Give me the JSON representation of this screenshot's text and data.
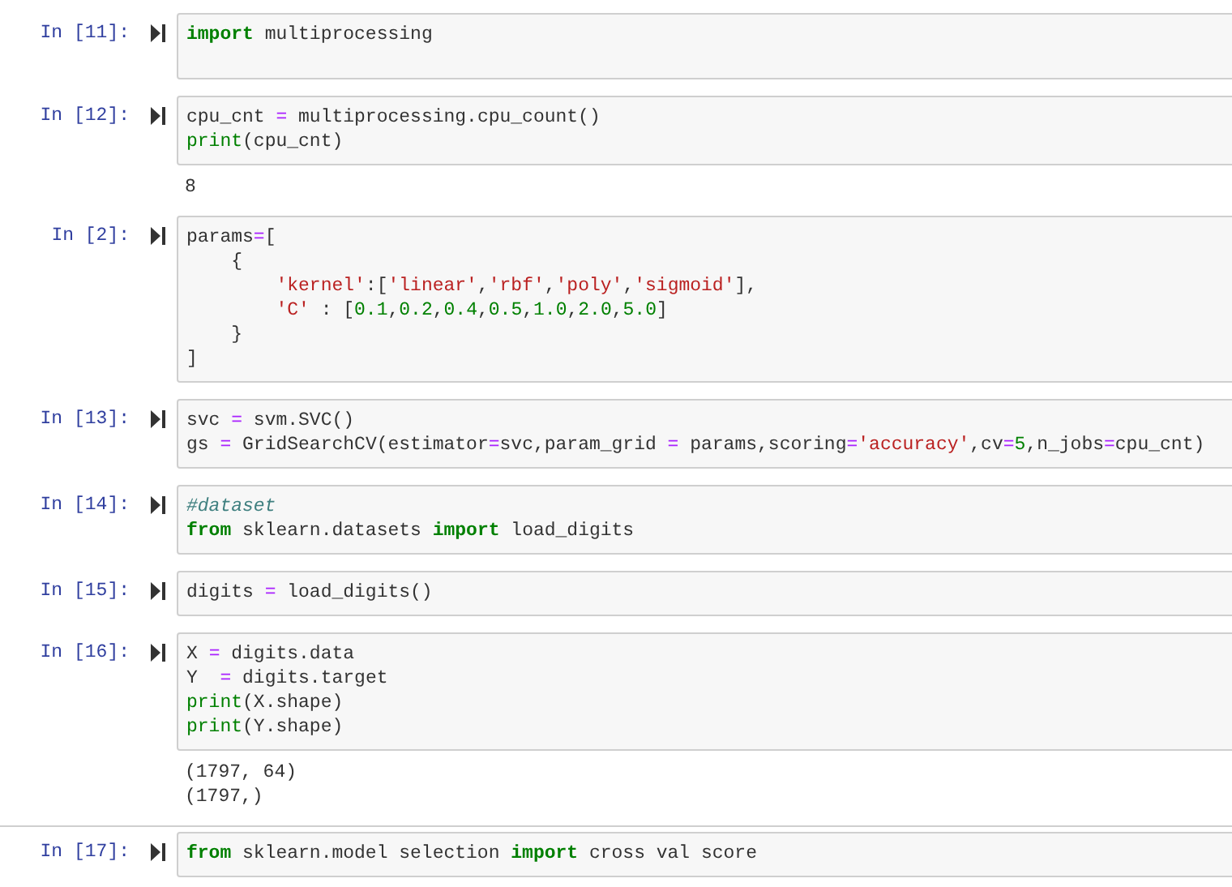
{
  "cells": [
    {
      "prompt": "In [11]:",
      "lines": [
        [
          {
            "kind": "kw",
            "text": "import"
          },
          {
            "kind": "p",
            "text": " multiprocessing"
          }
        ]
      ]
    },
    {
      "prompt": "In [12]:",
      "lines": [
        [
          {
            "kind": "p",
            "text": "cpu_cnt "
          },
          {
            "kind": "op",
            "text": "="
          },
          {
            "kind": "p",
            "text": " multiprocessing.cpu_count()"
          }
        ],
        [
          {
            "kind": "bi",
            "text": "print"
          },
          {
            "kind": "p",
            "text": "(cpu_cnt)"
          }
        ]
      ],
      "output": [
        "8"
      ]
    },
    {
      "prompt": "In [2]:",
      "lines": [
        [
          {
            "kind": "p",
            "text": "params"
          },
          {
            "kind": "op",
            "text": "="
          },
          {
            "kind": "p",
            "text": "["
          }
        ],
        [
          {
            "kind": "p",
            "text": "    {"
          }
        ],
        [
          {
            "kind": "str",
            "text": "        'kernel'"
          },
          {
            "kind": "p",
            "text": ":["
          },
          {
            "kind": "str",
            "text": "'linear'"
          },
          {
            "kind": "p",
            "text": ","
          },
          {
            "kind": "str",
            "text": "'rbf'"
          },
          {
            "kind": "p",
            "text": ","
          },
          {
            "kind": "str",
            "text": "'poly'"
          },
          {
            "kind": "p",
            "text": ","
          },
          {
            "kind": "str",
            "text": "'sigmoid'"
          },
          {
            "kind": "p",
            "text": "],"
          }
        ],
        [
          {
            "kind": "str",
            "text": "        'C'"
          },
          {
            "kind": "p",
            "text": " : ["
          },
          {
            "kind": "num",
            "text": "0.1"
          },
          {
            "kind": "p",
            "text": ","
          },
          {
            "kind": "num",
            "text": "0.2"
          },
          {
            "kind": "p",
            "text": ","
          },
          {
            "kind": "num",
            "text": "0.4"
          },
          {
            "kind": "p",
            "text": ","
          },
          {
            "kind": "num",
            "text": "0.5"
          },
          {
            "kind": "p",
            "text": ","
          },
          {
            "kind": "num",
            "text": "1.0"
          },
          {
            "kind": "p",
            "text": ","
          },
          {
            "kind": "num",
            "text": "2.0"
          },
          {
            "kind": "p",
            "text": ","
          },
          {
            "kind": "num",
            "text": "5.0"
          },
          {
            "kind": "p",
            "text": "]"
          }
        ],
        [
          {
            "kind": "p",
            "text": "    }"
          }
        ],
        [
          {
            "kind": "p",
            "text": "]"
          }
        ]
      ]
    },
    {
      "prompt": "In [13]:",
      "lines": [
        [
          {
            "kind": "p",
            "text": "svc "
          },
          {
            "kind": "op",
            "text": "="
          },
          {
            "kind": "p",
            "text": " svm.SVC()"
          }
        ],
        [
          {
            "kind": "p",
            "text": "gs "
          },
          {
            "kind": "op",
            "text": "="
          },
          {
            "kind": "p",
            "text": " GridSearchCV(estimator"
          },
          {
            "kind": "op",
            "text": "="
          },
          {
            "kind": "p",
            "text": "svc,param_grid "
          },
          {
            "kind": "op",
            "text": "="
          },
          {
            "kind": "p",
            "text": " params,scoring"
          },
          {
            "kind": "op",
            "text": "="
          },
          {
            "kind": "str",
            "text": "'accuracy'"
          },
          {
            "kind": "p",
            "text": ",cv"
          },
          {
            "kind": "op",
            "text": "="
          },
          {
            "kind": "num",
            "text": "5"
          },
          {
            "kind": "p",
            "text": ",n_jobs"
          },
          {
            "kind": "op",
            "text": "="
          },
          {
            "kind": "p",
            "text": "cpu_cnt)"
          }
        ]
      ]
    },
    {
      "prompt": "In [14]:",
      "lines": [
        [
          {
            "kind": "com",
            "text": "#dataset"
          }
        ],
        [
          {
            "kind": "kw",
            "text": "from"
          },
          {
            "kind": "p",
            "text": " sklearn.datasets "
          },
          {
            "kind": "kw",
            "text": "import"
          },
          {
            "kind": "p",
            "text": " load_digits"
          }
        ]
      ]
    },
    {
      "prompt": "In [15]:",
      "lines": [
        [
          {
            "kind": "p",
            "text": "digits "
          },
          {
            "kind": "op",
            "text": "="
          },
          {
            "kind": "p",
            "text": " load_digits()"
          }
        ]
      ]
    },
    {
      "prompt": "In [16]:",
      "lines": [
        [
          {
            "kind": "p",
            "text": "X "
          },
          {
            "kind": "op",
            "text": "="
          },
          {
            "kind": "p",
            "text": " digits.data"
          }
        ],
        [
          {
            "kind": "p",
            "text": "Y  "
          },
          {
            "kind": "op",
            "text": "="
          },
          {
            "kind": "p",
            "text": " digits.target"
          }
        ],
        [
          {
            "kind": "bi",
            "text": "print"
          },
          {
            "kind": "p",
            "text": "(X.shape)"
          }
        ],
        [
          {
            "kind": "bi",
            "text": "print"
          },
          {
            "kind": "p",
            "text": "(Y.shape)"
          }
        ]
      ],
      "output": [
        "(1797, 64)",
        "(1797,)"
      ]
    },
    {
      "prompt": "In [17]:",
      "lines": [
        [
          {
            "kind": "kw",
            "text": "from"
          },
          {
            "kind": "p",
            "text": " sklearn.model selection "
          },
          {
            "kind": "kw",
            "text": "import"
          },
          {
            "kind": "p",
            "text": " cross val score"
          }
        ]
      ]
    }
  ]
}
